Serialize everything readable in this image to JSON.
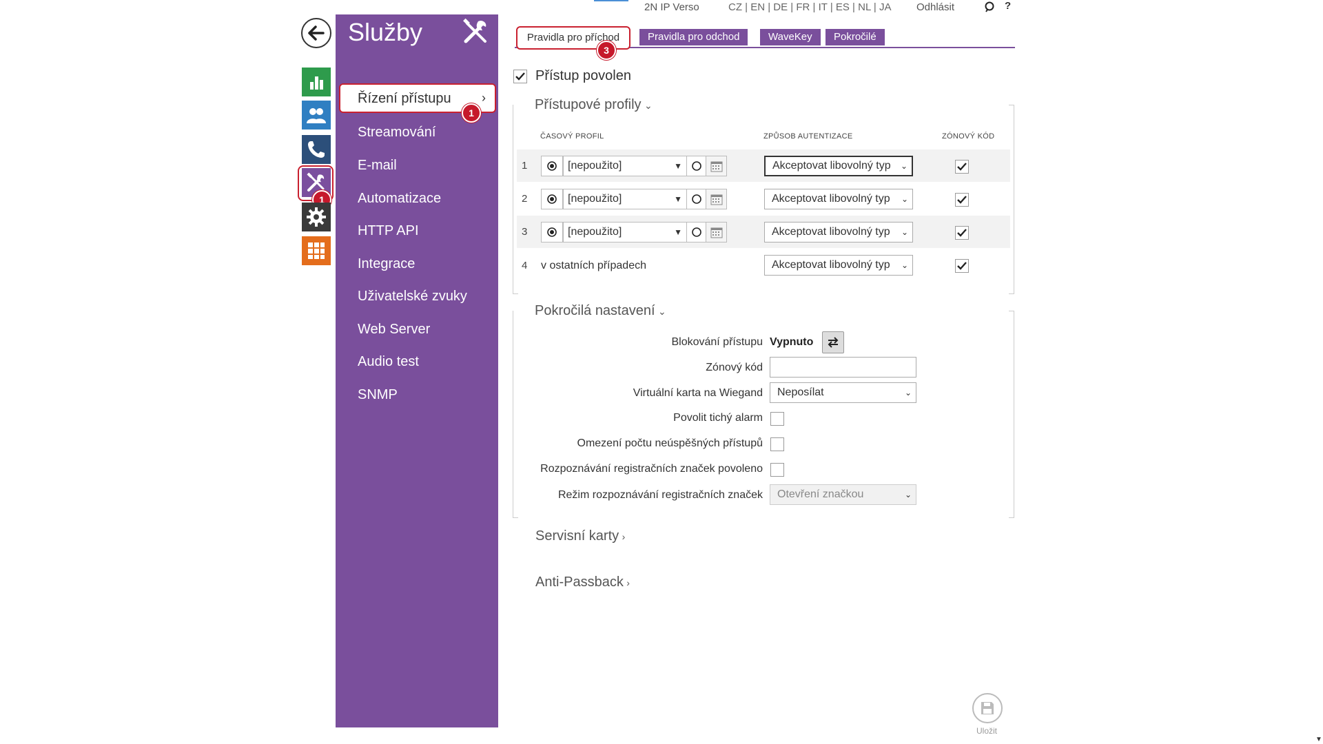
{
  "topbar": {
    "device_name": "2N IP Verso",
    "languages": "CZ | EN | DE | FR | IT | ES | NL | JA",
    "logout": "Odhlásit",
    "help": "?"
  },
  "menu": {
    "title": "Služby",
    "active_item": "Řízení přístupu",
    "items": [
      "Streamování",
      "E-mail",
      "Automatizace",
      "HTTP API",
      "Integrace",
      "Uživatelské zvuky",
      "Web Server",
      "Audio test",
      "SNMP"
    ]
  },
  "badges": {
    "menu": "1",
    "rail": "1",
    "tab": "3"
  },
  "tabs": {
    "active": "Pravidla pro příchod",
    "others": [
      "Pravidla pro odchod",
      "WaveKey",
      "Pokročilé"
    ]
  },
  "access": {
    "enabled_label": "Přístup povolen",
    "enabled": true
  },
  "profiles": {
    "title": "Přístupové profily",
    "col_time": "ČASOVÝ PROFIL",
    "col_auth": "ZPŮSOB AUTENTIZACE",
    "col_zone": "ZÓNOVÝ KÓD",
    "rows": [
      {
        "num": "1",
        "time": "[nepoužito]",
        "auth": "Akceptovat libovolný typ",
        "zone": true
      },
      {
        "num": "2",
        "time": "[nepoužito]",
        "auth": "Akceptovat libovolný typ",
        "zone": true
      },
      {
        "num": "3",
        "time": "[nepoužito]",
        "auth": "Akceptovat libovolný typ",
        "zone": true
      },
      {
        "num": "4",
        "time": "v ostatních případech",
        "auth": "Akceptovat libovolný typ",
        "zone": true
      }
    ]
  },
  "advanced": {
    "title": "Pokročilá nastavení",
    "block_label": "Blokování přístupu",
    "block_value": "Vypnuto",
    "zone_code_label": "Zónový kód",
    "zone_code_value": "",
    "wiegand_label": "Virtuální karta na Wiegand",
    "wiegand_value": "Neposílat",
    "silent_alarm_label": "Povolit tichý alarm",
    "limit_label": "Omezení počtu neúspěšných přístupů",
    "lpr_label": "Rozpoznávání registračních značek povoleno",
    "lpr_mode_label": "Režim rozpoznávání registračních značek",
    "lpr_mode_value": "Otevření značkou"
  },
  "sections": {
    "service_cards": "Servisní karty",
    "anti_passback": "Anti-Passback"
  },
  "save": {
    "label": "Uložit"
  }
}
